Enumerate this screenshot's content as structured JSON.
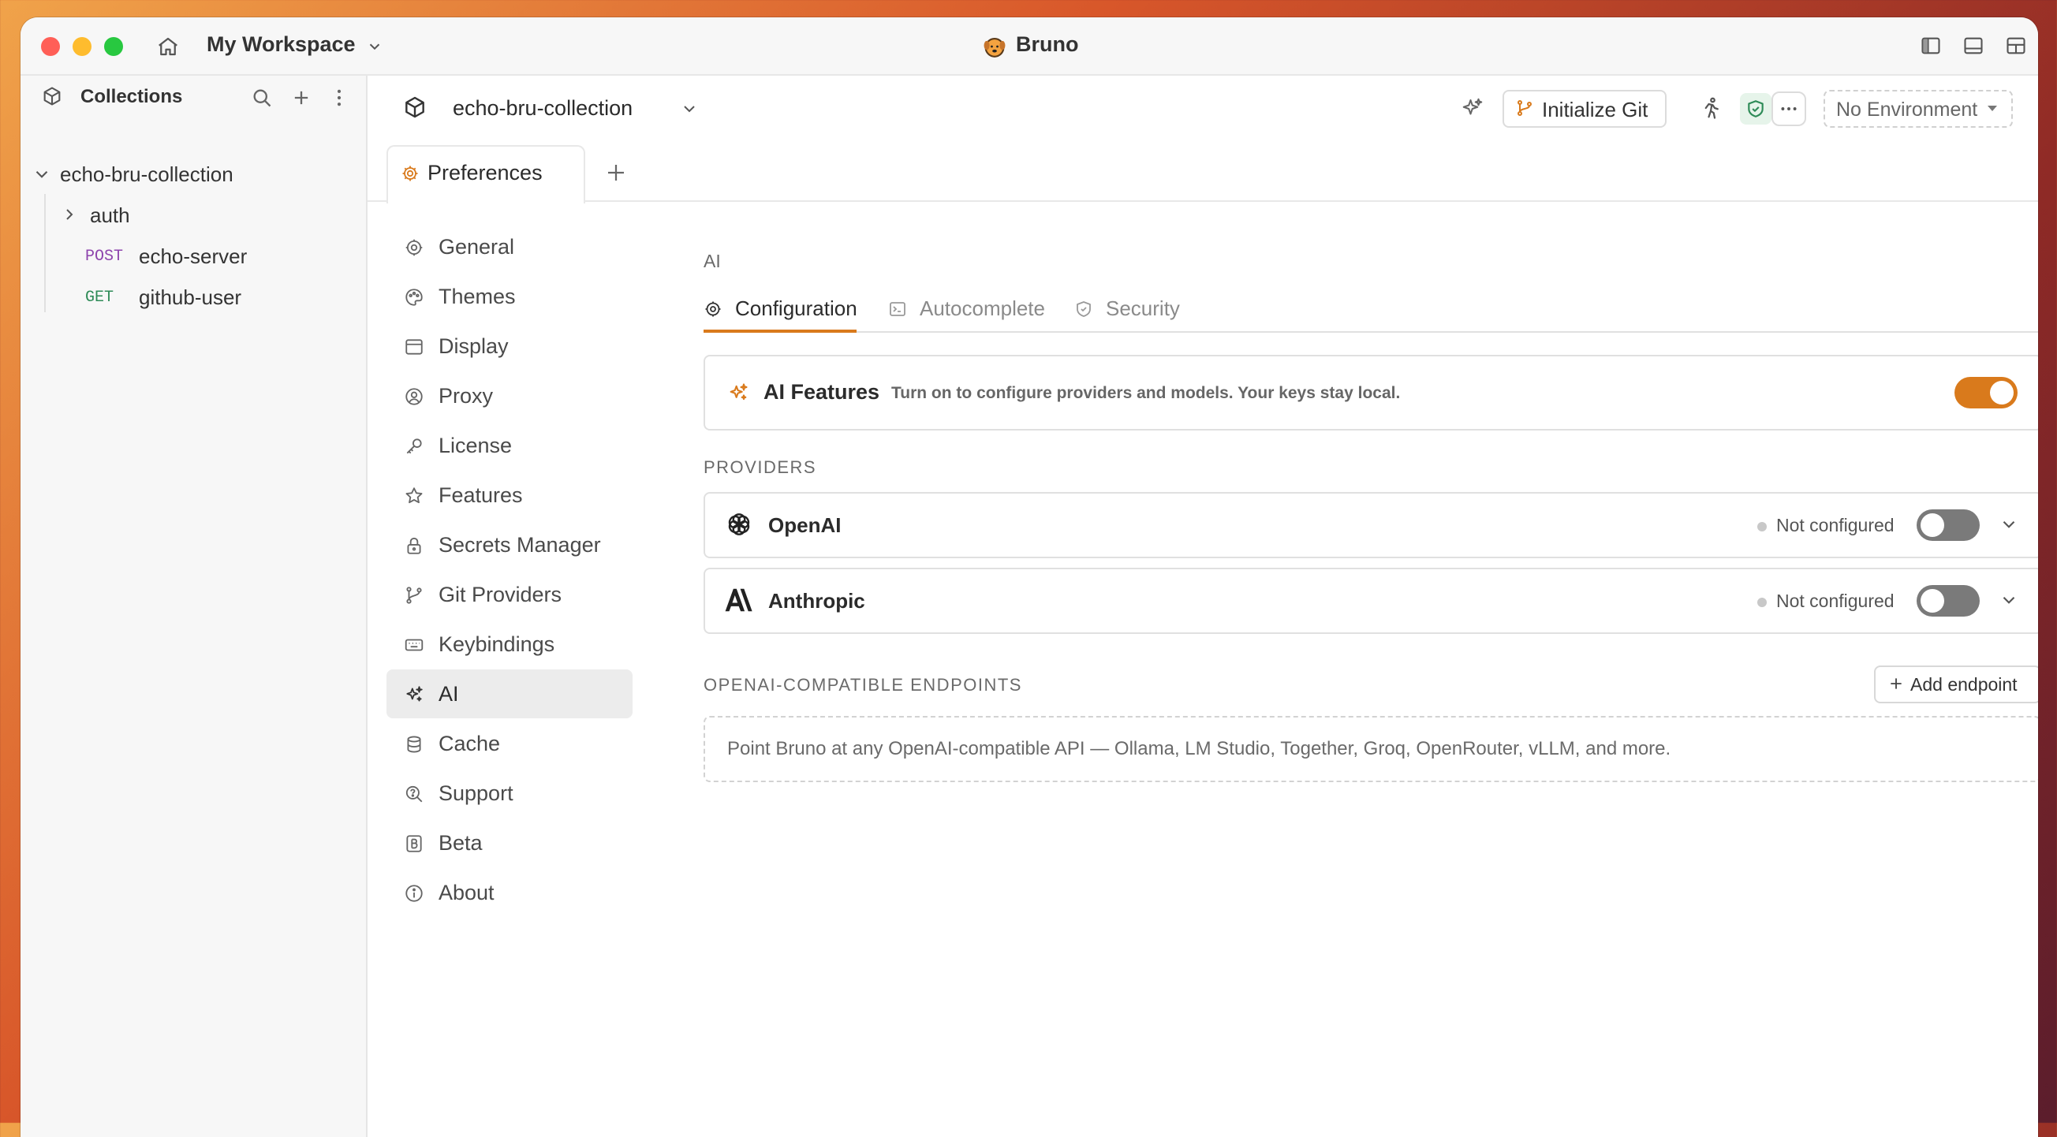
{
  "window": {
    "workspace_name": "My Workspace",
    "app_title": "Bruno"
  },
  "sidebar": {
    "title": "Collections",
    "collection": "echo-bru-collection",
    "items": [
      {
        "type": "folder",
        "label": "auth"
      },
      {
        "method": "POST",
        "label": "echo-server"
      },
      {
        "method": "GET",
        "label": "github-user"
      }
    ]
  },
  "header": {
    "collection_name": "echo-bru-collection",
    "init_git_label": "Initialize Git",
    "environment": "No Environment"
  },
  "tabs": {
    "active_tab": "Preferences"
  },
  "preferences": {
    "nav": [
      {
        "label": "General",
        "icon": "gear-icon"
      },
      {
        "label": "Themes",
        "icon": "palette-icon"
      },
      {
        "label": "Display",
        "icon": "display-icon"
      },
      {
        "label": "Proxy",
        "icon": "user-circle-icon"
      },
      {
        "label": "License",
        "icon": "key-icon"
      },
      {
        "label": "Features",
        "icon": "star-icon"
      },
      {
        "label": "Secrets Manager",
        "icon": "lock-icon"
      },
      {
        "label": "Git Providers",
        "icon": "git-branch-icon"
      },
      {
        "label": "Keybindings",
        "icon": "keyboard-icon"
      },
      {
        "label": "AI",
        "icon": "sparkles-icon",
        "active": true
      },
      {
        "label": "Cache",
        "icon": "database-icon"
      },
      {
        "label": "Support",
        "icon": "search-help-icon"
      },
      {
        "label": "Beta",
        "icon": "beta-icon"
      },
      {
        "label": "About",
        "icon": "info-icon"
      }
    ]
  },
  "ai": {
    "section_title": "AI",
    "subtabs": [
      "Configuration",
      "Autocomplete",
      "Security"
    ],
    "active_subtab": "Configuration",
    "features_title": "AI Features",
    "features_desc": "Turn on to configure providers and models. Your keys stay local.",
    "features_enabled": true,
    "providers_label": "PROVIDERS",
    "providers": [
      {
        "name": "OpenAI",
        "status": "Not configured",
        "enabled": false
      },
      {
        "name": "Anthropic",
        "status": "Not configured",
        "enabled": false
      }
    ],
    "endpoints_label": "OPENAI-COMPATIBLE ENDPOINTS",
    "add_endpoint_label": "Add endpoint",
    "endpoints_hint": "Point Bruno at any OpenAI-compatible API — Ollama, LM Studio, Together, Groq, OpenRouter, vLLM, and more.",
    "accent_color": "#d97a1c"
  }
}
